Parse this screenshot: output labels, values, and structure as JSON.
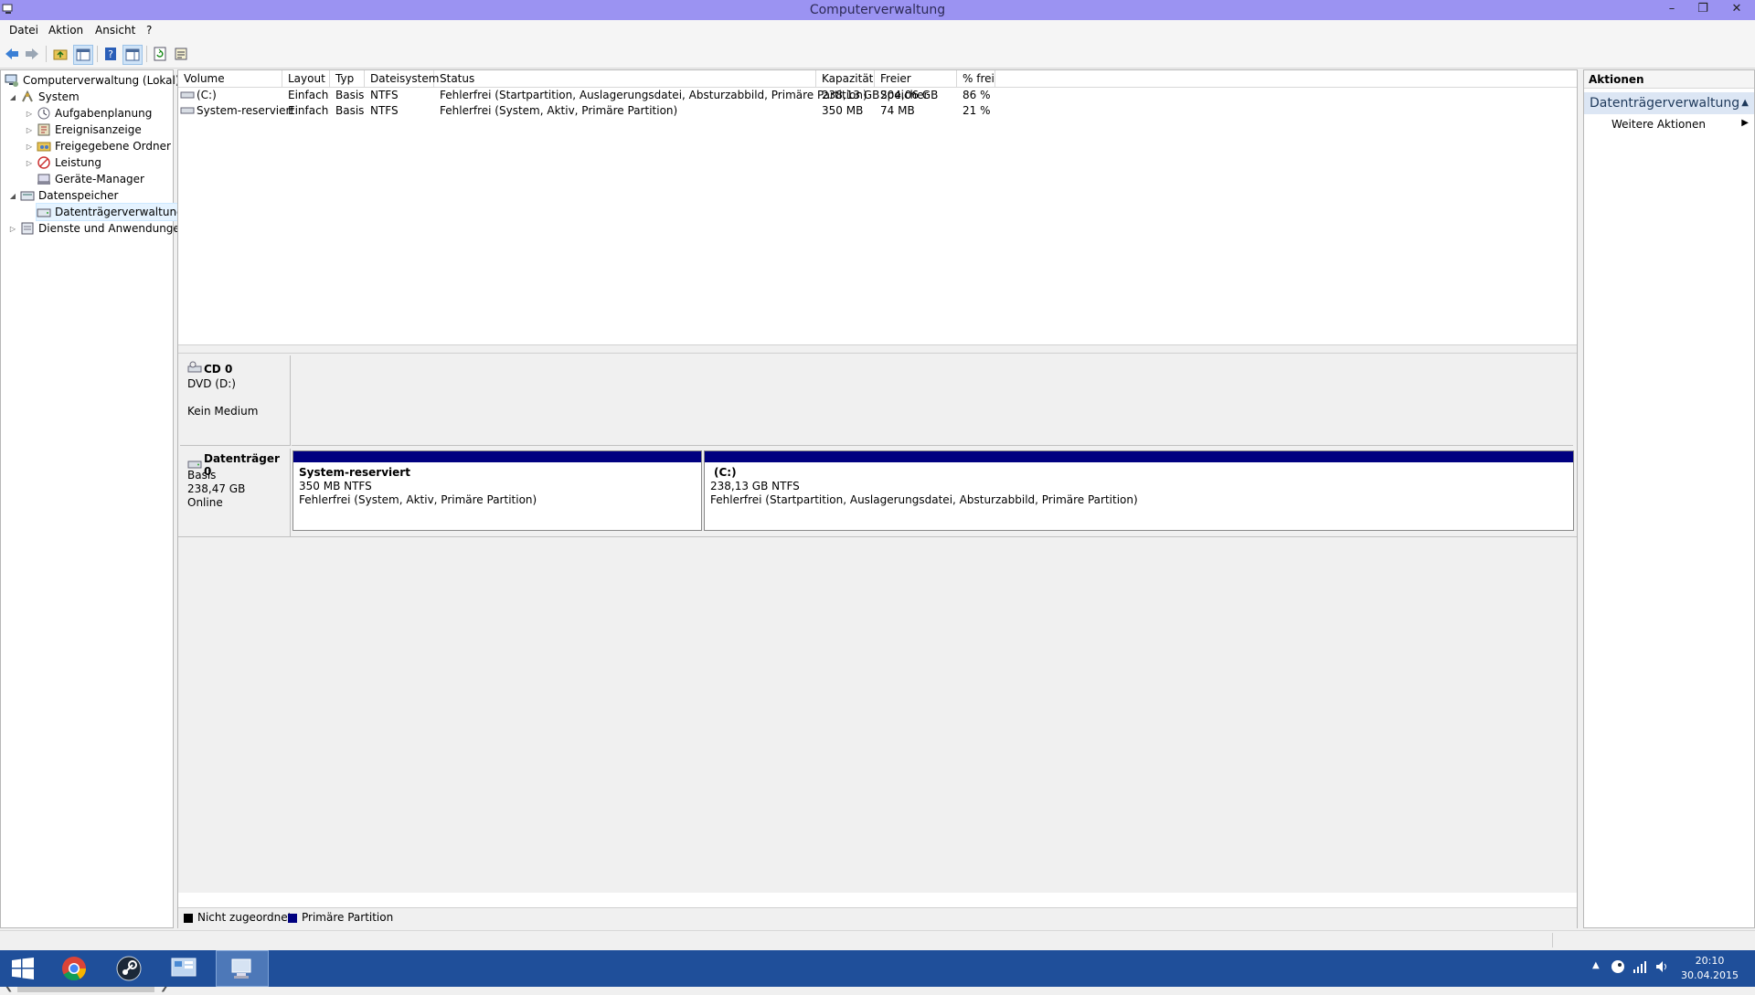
{
  "window": {
    "title": "Computerverwaltung"
  },
  "menu": [
    "Datei",
    "Aktion",
    "Ansicht",
    "?"
  ],
  "tree": {
    "root": "Computerverwaltung (Lokal)",
    "system": "System",
    "aufgaben": "Aufgabenplanung",
    "ereignis": "Ereignisanzeige",
    "freigabe": "Freigegebene Ordner",
    "leistung": "Leistung",
    "geraete": "Geräte-Manager",
    "datenspeicher": "Datenspeicher",
    "datentraeger": "Datenträgerverwaltung",
    "dienste": "Dienste und Anwendungen"
  },
  "volumes": {
    "columns": [
      "Volume",
      "Layout",
      "Typ",
      "Dateisystem",
      "Status",
      "Kapazität",
      "Freier Speicher",
      "% frei"
    ],
    "rows": [
      [
        "(C:)",
        "Einfach",
        "Basis",
        "NTFS",
        "Fehlerfrei (Startpartition, Auslagerungsdatei, Absturzabbild, Primäre Partition)",
        "238,13 GB",
        "204,06 GB",
        "86 %"
      ],
      [
        "System-reserviert",
        "Einfach",
        "Basis",
        "NTFS",
        "Fehlerfrei (System, Aktiv, Primäre Partition)",
        "350 MB",
        "74 MB",
        "21 %"
      ]
    ]
  },
  "disks": {
    "cd": {
      "name": "CD 0",
      "type": "DVD (D:)",
      "status": "Kein Medium"
    },
    "disk0": {
      "name": "Datenträger 0",
      "type": "Basis",
      "size": "238,47 GB",
      "status": "Online",
      "p1": {
        "name": "System-reserviert",
        "size": "350 MB NTFS",
        "status": "Fehlerfrei (System, Aktiv, Primäre Partition)"
      },
      "p2": {
        "name": "(C:)",
        "size": "238,13 GB NTFS",
        "status": "Fehlerfrei (Startpartition, Auslagerungsdatei, Absturzabbild, Primäre Partition)"
      }
    }
  },
  "legend": {
    "unallocated": "Nicht zugeordnet",
    "primary": "Primäre Partition"
  },
  "actions": {
    "header": "Aktionen",
    "section": "Datenträgerverwaltung",
    "more": "Weitere Aktionen"
  },
  "clock": {
    "time": "20:10",
    "date": "30.04.2015"
  },
  "colors": {
    "title_bar": "#9b93f2",
    "partition_bar": "#000080",
    "taskbar": "#1f4f9a",
    "action_section": "#dce6f4"
  },
  "icons": [
    "back-arrow-icon",
    "forward-arrow-icon",
    "folder-up-icon",
    "console-tree-icon",
    "help-icon",
    "properties-icon",
    "refresh-icon",
    "export-icon"
  ]
}
